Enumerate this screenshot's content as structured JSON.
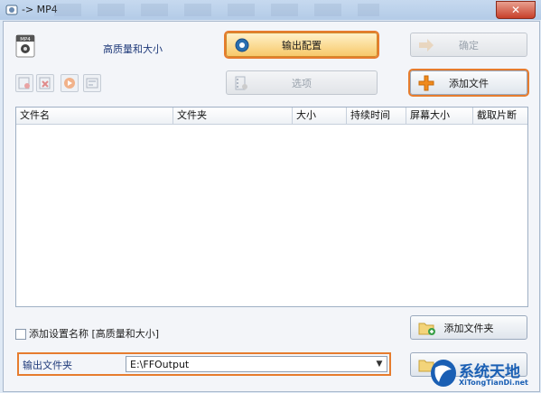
{
  "window": {
    "title": "-> MP4",
    "close_symbol": "✕"
  },
  "preset": {
    "label": "高质量和大小",
    "badge": "MP4"
  },
  "buttons": {
    "output_config": "输出配置",
    "ok": "确定",
    "options": "选项",
    "add_file": "添加文件",
    "add_folder": "添加文件夹"
  },
  "table": {
    "columns": [
      "文件名",
      "文件夹",
      "大小",
      "持续时间",
      "屏幕大小",
      "截取片断"
    ],
    "rows": []
  },
  "checkbox": {
    "label": "添加设置名称 [高质量和大小]",
    "checked": false
  },
  "output_folder": {
    "label": "输出文件夹",
    "value": "E:\\FFOutput"
  },
  "watermark": {
    "brand": "系统天地",
    "url": "XiTongTianDi.net"
  },
  "colors": {
    "highlight": "#e67c2e",
    "accent": "#1f3a7a"
  }
}
